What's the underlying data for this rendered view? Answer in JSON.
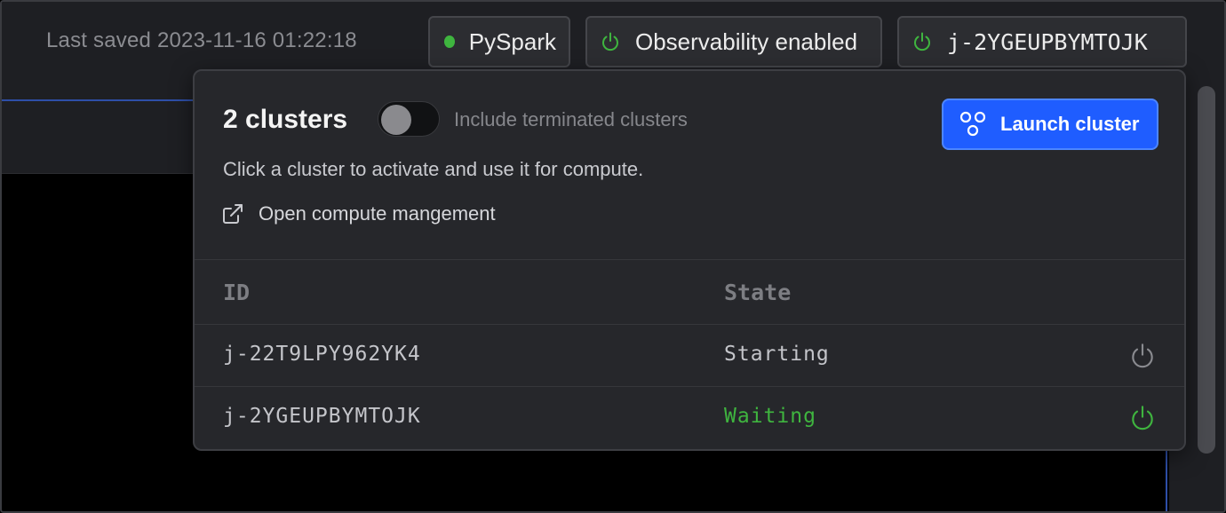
{
  "header": {
    "last_saved": "Last saved 2023-11-16 01:22:18",
    "kernel_chip": {
      "label": "PySpark",
      "status_color": "#3fb53f"
    },
    "observability_chip": {
      "label": "Observability enabled",
      "icon": "power-icon",
      "icon_color": "#3fb53f"
    },
    "cluster_chip": {
      "label": "j-2YGEUPBYMTOJK",
      "icon": "power-icon",
      "icon_color": "#3fb53f"
    }
  },
  "popover": {
    "title": "2 clusters",
    "toggle": {
      "label": "Include terminated clusters",
      "on": false
    },
    "launch_button": {
      "label": "Launch cluster",
      "icon": "cluster-icon",
      "color": "#1f5dff"
    },
    "help_text": "Click a cluster to activate and use it for compute.",
    "management_link": {
      "label": "Open compute mangement",
      "icon": "external-link-icon"
    },
    "table": {
      "columns": [
        "ID",
        "State"
      ],
      "rows": [
        {
          "id": "j-22T9LPY962YK4",
          "state": "Starting",
          "state_color": "#c4c5ca",
          "action_icon": "power-icon",
          "action_color": "#8a8b90"
        },
        {
          "id": "j-2YGEUPBYMTOJK",
          "state": "Waiting",
          "state_color": "#3fb53f",
          "action_icon": "power-icon",
          "action_color": "#3fb53f"
        }
      ]
    }
  }
}
